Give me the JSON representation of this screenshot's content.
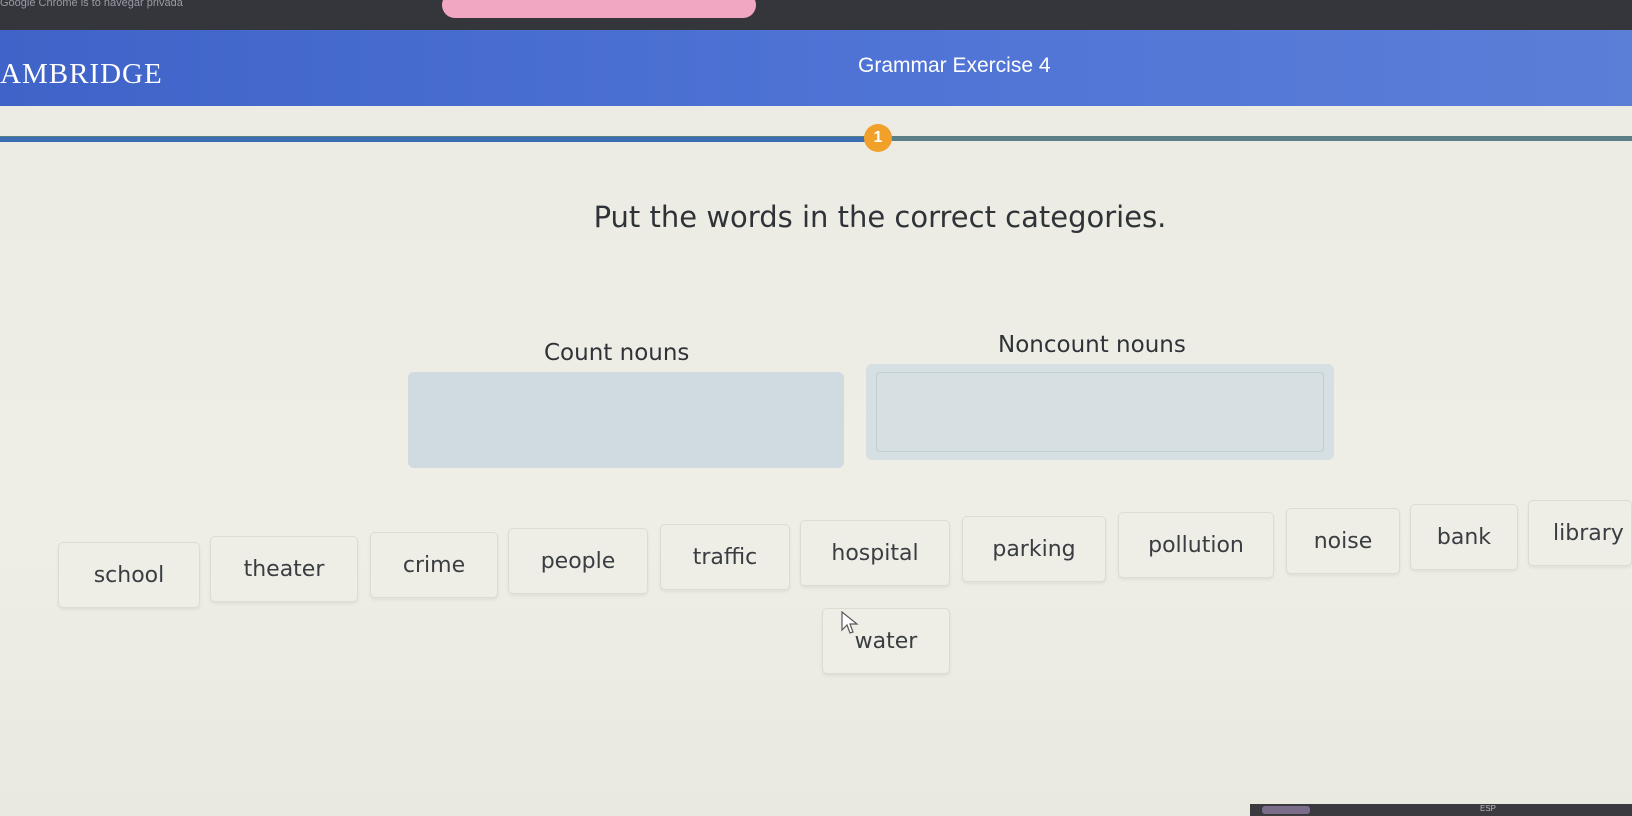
{
  "browser": {
    "url_fragment": "Google Chrome is to navegar privada"
  },
  "header": {
    "brand": "AMBRIDGE",
    "title": "Grammar Exercise 4"
  },
  "progress": {
    "current_step": "1"
  },
  "exercise": {
    "instruction": "Put the words in the correct categories.",
    "categories": [
      {
        "label": "Count nouns"
      },
      {
        "label": "Noncount nouns"
      }
    ],
    "words": [
      "school",
      "theater",
      "crime",
      "people",
      "traffic",
      "hospital",
      "parking",
      "pollution",
      "noise",
      "bank",
      "library",
      "water"
    ]
  },
  "system": {
    "keyboard_hint": "ESP"
  },
  "colors": {
    "header_blue": "#4a6fd3",
    "step_orange": "#f1a029",
    "progress_blue": "#3c6db0",
    "active_tab_pink": "#f1a7c2"
  }
}
